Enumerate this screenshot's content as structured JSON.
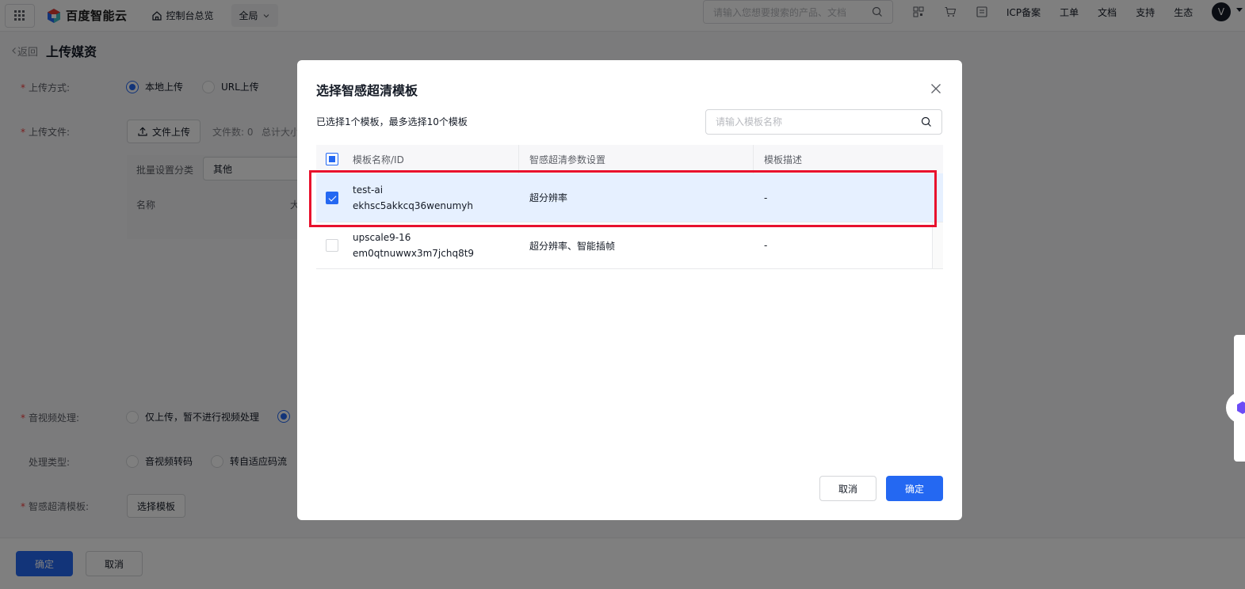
{
  "topbar": {
    "brand": "百度智能云",
    "console_home": "控制台总览",
    "region": "全局",
    "search_placeholder": "请输入您想要搜索的产品、文档",
    "links": [
      "ICP备案",
      "工单",
      "文档",
      "支持",
      "生态"
    ],
    "avatar_initial": "V"
  },
  "page": {
    "back": "返回",
    "title": "上传媒资",
    "upload_method_label": "上传方式:",
    "upload_local": "本地上传",
    "upload_url": "URL上传",
    "upload_file_label": "上传文件:",
    "file_upload_btn": "文件上传",
    "file_count": "文件数: 0",
    "total_size": "总计大小",
    "batch_category_label": "批量设置分类",
    "batch_category_value": "其他",
    "name_col": "名称",
    "size_col": "大",
    "av_process_label": "音视频处理:",
    "av_process_opt1": "仅上传，暂不进行视频处理",
    "process_type_label": "处理类型:",
    "process_type_opt1": "音视频转码",
    "process_type_opt2": "转自适应码流",
    "smart_template_label": "智感超清模板:",
    "select_template_btn": "选择模板",
    "confirm": "确定",
    "cancel": "取消"
  },
  "modal": {
    "title": "选择智感超清模板",
    "selection_info": "已选择1个模板，最多选择10个模板",
    "search_placeholder": "请输入模板名称",
    "columns": [
      "模板名称/ID",
      "智感超清参数设置",
      "模板描述"
    ],
    "rows": [
      {
        "name": "test-ai",
        "id": "ekhsc5akkcq36wenumyh",
        "params": "超分辨率",
        "desc": "-",
        "checked": true
      },
      {
        "name": "upscale9-16",
        "id": "em0qtnuwwx3m7jchq8t9",
        "params": "超分辨率、智能插帧",
        "desc": "-",
        "checked": false
      }
    ],
    "cancel": "取消",
    "confirm": "确定"
  },
  "colors": {
    "primary": "#2468f2",
    "selected_row": "#e6f0ff",
    "highlight": "#e8112d"
  }
}
